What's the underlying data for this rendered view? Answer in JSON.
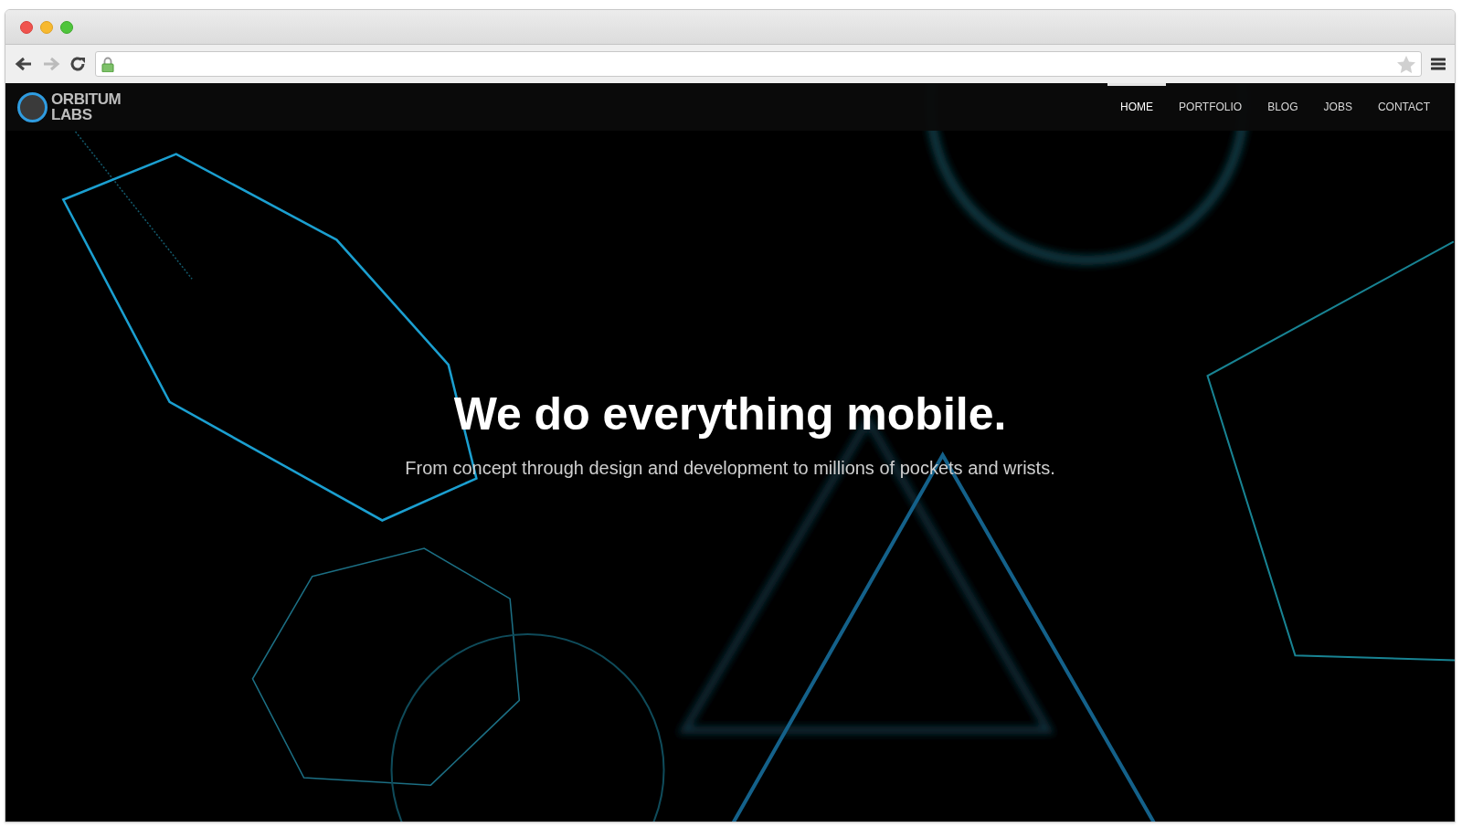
{
  "logo": {
    "lines": [
      "ORBITUM",
      "LABS"
    ]
  },
  "nav": [
    {
      "label": "HOME",
      "selected": true
    },
    {
      "label": "PORTFOLIO",
      "selected": false
    },
    {
      "label": "BLOG",
      "selected": false
    },
    {
      "label": "JOBS",
      "selected": false
    },
    {
      "label": "CONTACT",
      "selected": false
    }
  ],
  "hero": {
    "title": "We do everything mobile.",
    "subtitle": "From concept through design and development to millions of pockets and wrists."
  }
}
